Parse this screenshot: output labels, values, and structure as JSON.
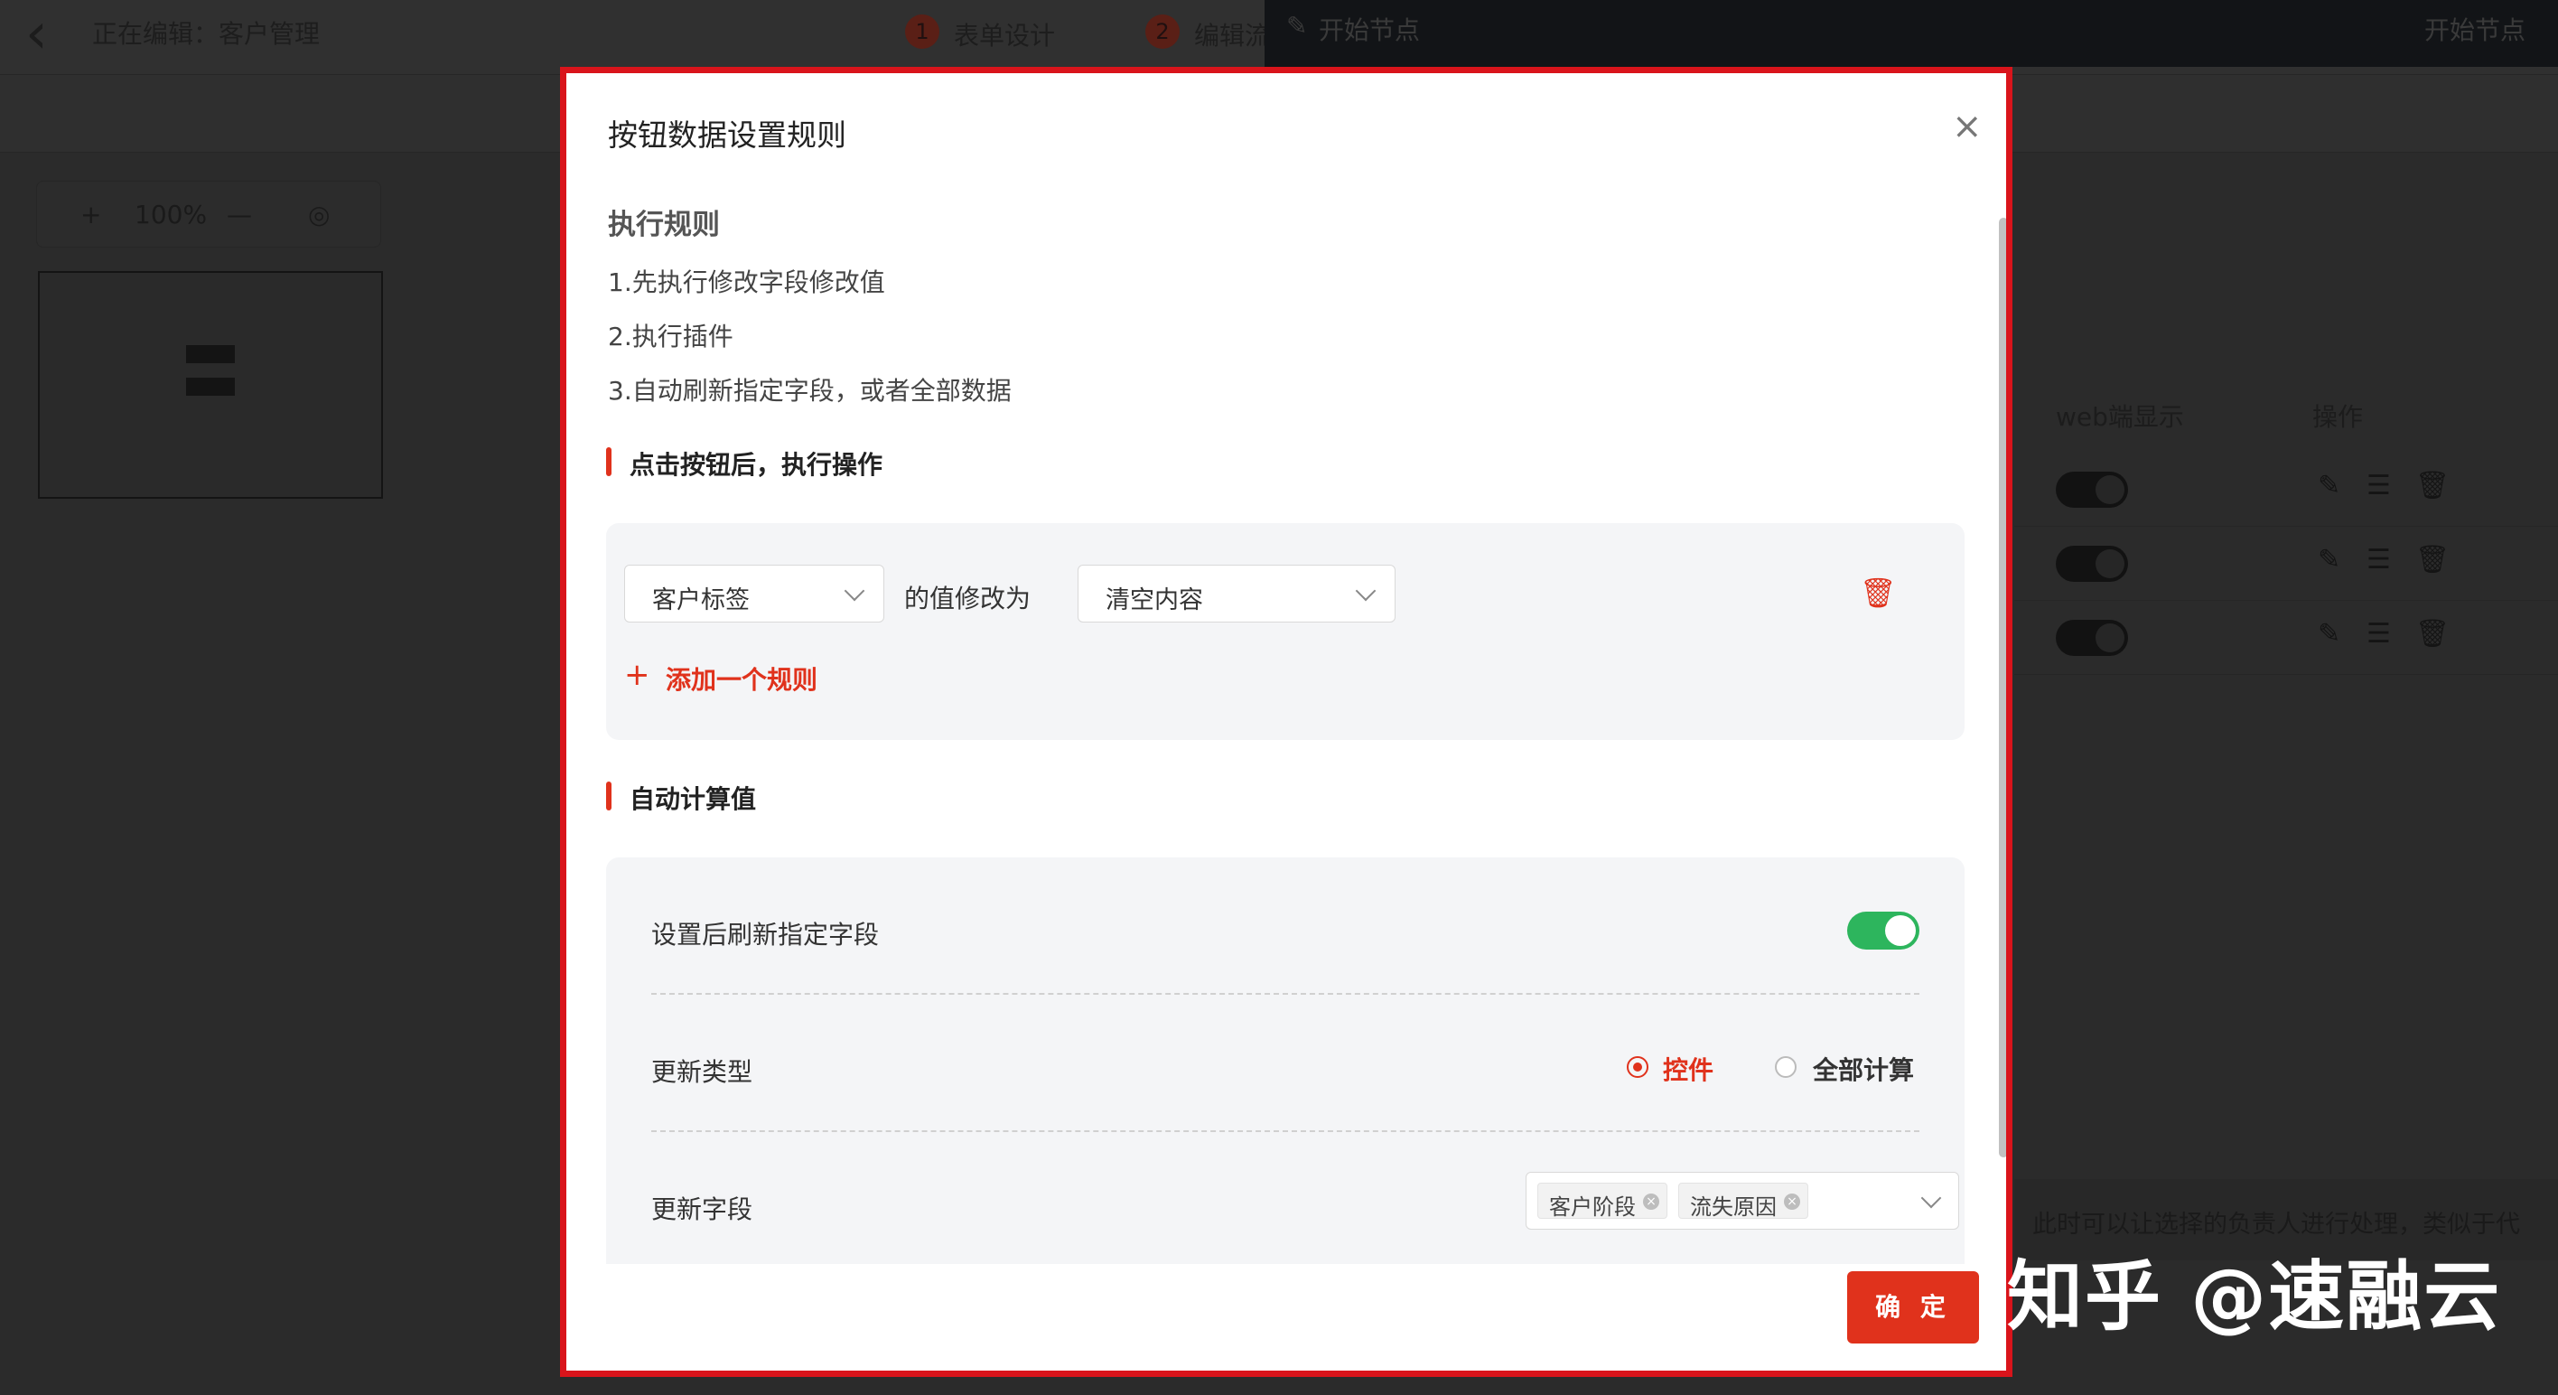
{
  "app": {
    "editing_title": "正在编辑：客户管理",
    "steps": [
      {
        "num": "1",
        "label": "表单设计"
      },
      {
        "num": "2",
        "label": "编辑流"
      }
    ],
    "right_panel_title": "开始节点",
    "right_panel_title_right": "开始节点",
    "zoom_level": "100%",
    "table_headers": {
      "web_display": "web端显示",
      "actions": "操作"
    },
    "banner_text": "此时可以让选择的负责人进行处理，类似于代"
  },
  "modal": {
    "title": "按钮数据设置规则",
    "rules_heading": "执行规则",
    "rules": [
      "1.先执行修改字段修改值",
      "2.执行插件",
      "3.自动刷新指定字段，或者全部数据"
    ],
    "section_action": {
      "title": "点击按钮后，执行操作",
      "field_select": "客户标签",
      "middle_label": "的值修改为",
      "value_select": "清空内容",
      "add_rule": "添加一个规则"
    },
    "section_auto": {
      "title": "自动计算值",
      "refresh_label": "设置后刷新指定字段",
      "refresh_enabled": true,
      "update_type_label": "更新类型",
      "update_type_options": [
        "控件",
        "全部计算"
      ],
      "update_type_selected": "控件",
      "update_fields_label": "更新字段",
      "update_fields_tags": [
        "客户阶段",
        "流失原因"
      ]
    },
    "confirm_button": "确 定"
  },
  "watermark": "知乎 @速融云",
  "colors": {
    "accent": "#e0321c",
    "switch_on": "#2db55d",
    "modal_border": "#d9141b"
  }
}
